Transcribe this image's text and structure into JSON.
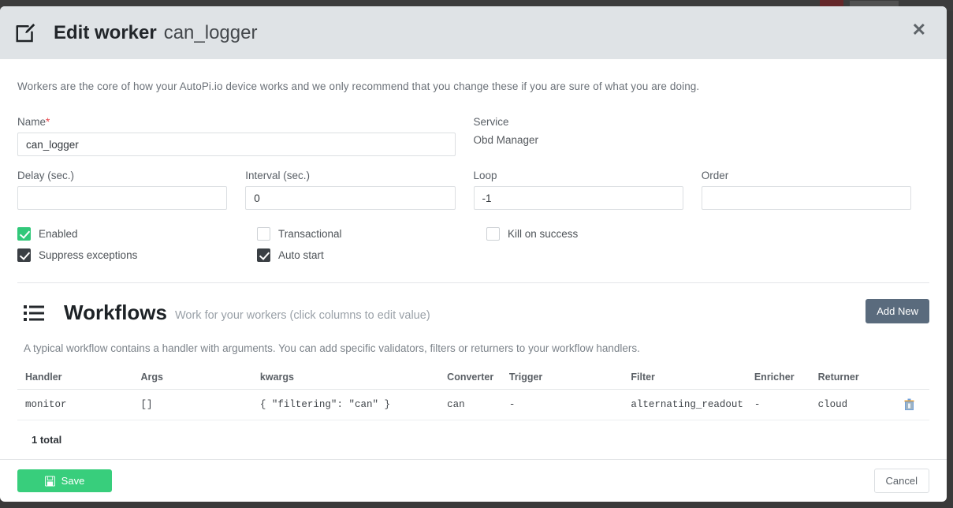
{
  "header": {
    "title_strong": "Edit worker",
    "title_light": "can_logger",
    "edit_icon": "edit-pencil-square-icon",
    "close_label": "✕"
  },
  "intro": "Workers are the core of how your AutoPi.io device works and we only recommend that you change these if you are sure of what you are doing.",
  "form": {
    "name": {
      "label": "Name",
      "required_mark": "*",
      "value": "can_logger"
    },
    "service": {
      "label": "Service",
      "value": "Obd Manager"
    },
    "delay": {
      "label": "Delay (sec.)",
      "value": ""
    },
    "interval": {
      "label": "Interval (sec.)",
      "value": "0"
    },
    "loop": {
      "label": "Loop",
      "value": "-1"
    },
    "order": {
      "label": "Order",
      "value": ""
    },
    "checkboxes": [
      {
        "label": "Enabled",
        "checked": true,
        "style": "green"
      },
      {
        "label": "Transactional",
        "checked": false,
        "style": "empty"
      },
      {
        "label": "Kill on success",
        "checked": false,
        "style": "empty"
      },
      {
        "label": "Suppress exceptions",
        "checked": true,
        "style": "dark"
      },
      {
        "label": "Auto start",
        "checked": true,
        "style": "dark"
      }
    ]
  },
  "workflows": {
    "icon": "list-icon",
    "title": "Workflows",
    "subtitle": "Work for your workers (click columns to edit value)",
    "add_new_label": "Add New",
    "description": "A typical workflow contains a handler with arguments. You can add specific validators, filters or returners to your workflow handlers.",
    "columns": [
      "Handler",
      "Args",
      "kwargs",
      "Converter",
      "Trigger",
      "Filter",
      "Enricher",
      "Returner"
    ],
    "rows": [
      {
        "handler": "monitor",
        "args": "[]",
        "kwargs": "{ \"filtering\": \"can\" }",
        "converter": "can",
        "trigger": "-",
        "filter": "alternating_readout",
        "enricher": "-",
        "returner": "cloud",
        "delete_icon": "trash-icon"
      }
    ],
    "total": "1 total"
  },
  "footer": {
    "save_label": "Save",
    "save_icon": "save-disk-icon",
    "cancel_label": "Cancel"
  },
  "colors": {
    "header_bg": "#dfe3e6",
    "green": "#38ce7c",
    "checkbox_green": "#32c87a",
    "checkbox_dark": "#3a3f44",
    "add_new": "#5a6b7d",
    "required_red": "#e8474c"
  }
}
